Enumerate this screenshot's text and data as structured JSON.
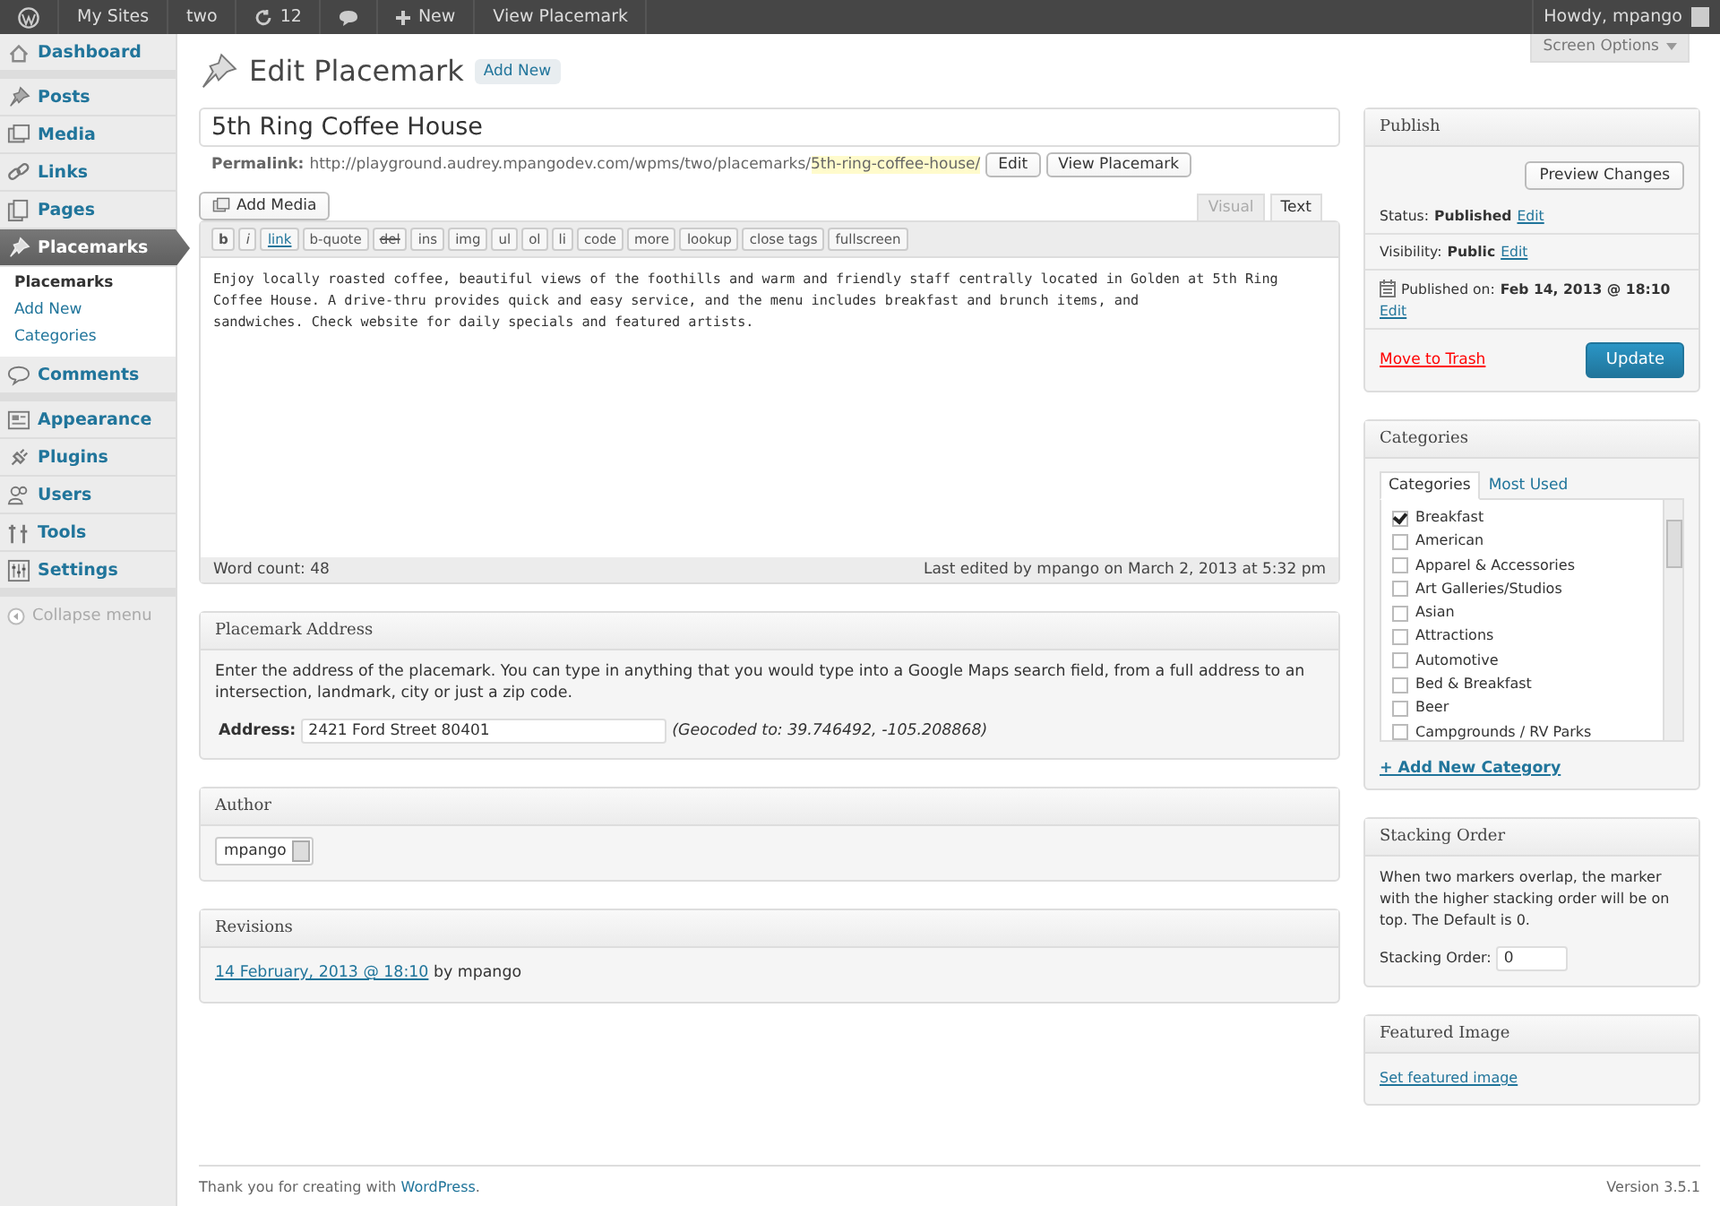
{
  "admin_bar": {
    "items": [
      {
        "kind": "logo"
      },
      {
        "kind": "text",
        "label": "My Sites"
      },
      {
        "kind": "text",
        "label": "two"
      },
      {
        "kind": "updates",
        "label": "12"
      },
      {
        "kind": "comments"
      },
      {
        "kind": "new",
        "label": "New"
      },
      {
        "kind": "text",
        "label": "View Placemark"
      }
    ],
    "account": "Howdy, mpango"
  },
  "sidebar": {
    "groups": [
      [
        {
          "label": "Dashboard",
          "kind": "dashboard",
          "selected": false
        }
      ],
      [
        {
          "label": "Posts",
          "kind": "posts",
          "selected": false
        },
        {
          "label": "Media",
          "kind": "media",
          "selected": false
        },
        {
          "label": "Links",
          "kind": "links",
          "selected": false
        },
        {
          "label": "Pages",
          "kind": "pages",
          "selected": false
        },
        {
          "label": "Placemarks",
          "kind": "placemarks",
          "selected": true,
          "children": [
            {
              "label": "Placemarks",
              "selected": true
            },
            {
              "label": "Add New",
              "selected": false
            },
            {
              "label": "Categories",
              "selected": false
            }
          ]
        },
        {
          "label": "Comments",
          "kind": "comments",
          "selected": false
        }
      ],
      [
        {
          "label": "Appearance",
          "kind": "appearance",
          "selected": false
        },
        {
          "label": "Plugins",
          "kind": "plugins",
          "selected": false
        },
        {
          "label": "Users",
          "kind": "users",
          "selected": false
        },
        {
          "label": "Tools",
          "kind": "tools",
          "selected": false
        },
        {
          "label": "Settings",
          "kind": "settings",
          "selected": false
        }
      ]
    ],
    "collapse": "Collapse menu"
  },
  "screen_options": "Screen Options",
  "page": {
    "title": "Edit Placemark",
    "add_new": "Add New"
  },
  "post": {
    "title": "5th Ring Coffee House",
    "permalink_label": "Permalink:",
    "permalink_base": "http://playground.audrey.mpangodev.com/wpms/two/placemarks/",
    "permalink_slug": "5th-ring-coffee-house/",
    "permalink_buttons": [
      "Edit",
      "View Placemark"
    ]
  },
  "editor": {
    "add_media": "Add Media",
    "tabs": [
      {
        "label": "Visual",
        "selected": false
      },
      {
        "label": "Text",
        "selected": true
      }
    ],
    "quicktags": [
      {
        "label": "b",
        "kind": "bold"
      },
      {
        "label": "i",
        "kind": "italic"
      },
      {
        "label": "link",
        "kind": "link"
      },
      {
        "label": "b-quote",
        "kind": "plain"
      },
      {
        "label": "del",
        "kind": "strike"
      },
      {
        "label": "ins",
        "kind": "plain"
      },
      {
        "label": "img",
        "kind": "plain"
      },
      {
        "label": "ul",
        "kind": "plain"
      },
      {
        "label": "ol",
        "kind": "plain"
      },
      {
        "label": "li",
        "kind": "plain"
      },
      {
        "label": "code",
        "kind": "plain"
      },
      {
        "label": "more",
        "kind": "plain"
      },
      {
        "label": "lookup",
        "kind": "plain"
      },
      {
        "label": "close tags",
        "kind": "plain"
      },
      {
        "label": "fullscreen",
        "kind": "plain"
      }
    ],
    "content": "Enjoy locally roasted coffee, beautiful views of the foothills and warm and friendly staff centrally located in Golden at 5th Ring Coffee House. A drive-thru provides quick and easy service, and the menu includes breakfast and brunch items, and\nsandwiches. Check website for daily specials and featured artists.",
    "word_count": "Word count: 48",
    "last_edited": "Last edited by mpango on March 2, 2013 at 5:32 pm"
  },
  "address_box": {
    "title": "Placemark Address",
    "description": "Enter the address of the placemark. You can type in anything that you would type into a Google Maps search field, from a full address to an intersection, landmark, city or just a zip code.",
    "label": "Address:",
    "value": "2421 Ford Street 80401",
    "geocoded": "(Geocoded to: 39.746492, -105.208868)"
  },
  "author_box": {
    "title": "Author",
    "value": "mpango"
  },
  "revisions_box": {
    "title": "Revisions",
    "entries": [
      {
        "link": "14 February, 2013 @ 18:10",
        "by": "by mpango"
      }
    ]
  },
  "publish_box": {
    "title": "Publish",
    "preview": "Preview Changes",
    "status_label": "Status:",
    "status": "Published",
    "status_edit": "Edit",
    "visibility_label": "Visibility:",
    "visibility": "Public",
    "visibility_edit": "Edit",
    "published_label": "Published on:",
    "published": "Feb 14, 2013 @ 18:10",
    "published_edit": "Edit",
    "trash": "Move to Trash",
    "update": "Update"
  },
  "categories_box": {
    "title": "Categories",
    "tabs": [
      {
        "label": "Categories",
        "selected": true
      },
      {
        "label": "Most Used",
        "selected": false
      }
    ],
    "items": [
      {
        "label": "Breakfast",
        "checked": true
      },
      {
        "label": "American",
        "checked": false
      },
      {
        "label": "Apparel & Accessories",
        "checked": false
      },
      {
        "label": "Art Galleries/Studios",
        "checked": false
      },
      {
        "label": "Asian",
        "checked": false
      },
      {
        "label": "Attractions",
        "checked": false
      },
      {
        "label": "Automotive",
        "checked": false
      },
      {
        "label": "Bed & Breakfast",
        "checked": false
      },
      {
        "label": "Beer",
        "checked": false
      },
      {
        "label": "Campgrounds / RV Parks",
        "checked": false
      }
    ],
    "add_new": "+ Add New Category"
  },
  "stacking_box": {
    "title": "Stacking Order",
    "description": "When two markers overlap, the marker with the higher stacking order will be on top. The Default is 0.",
    "label": "Stacking Order:",
    "value": "0"
  },
  "featured_box": {
    "title": "Featured Image",
    "link": "Set featured image"
  },
  "footer": {
    "thanks": "Thank you for creating with",
    "link": "WordPress",
    "end": ".",
    "version": "Version 3.5.1"
  }
}
